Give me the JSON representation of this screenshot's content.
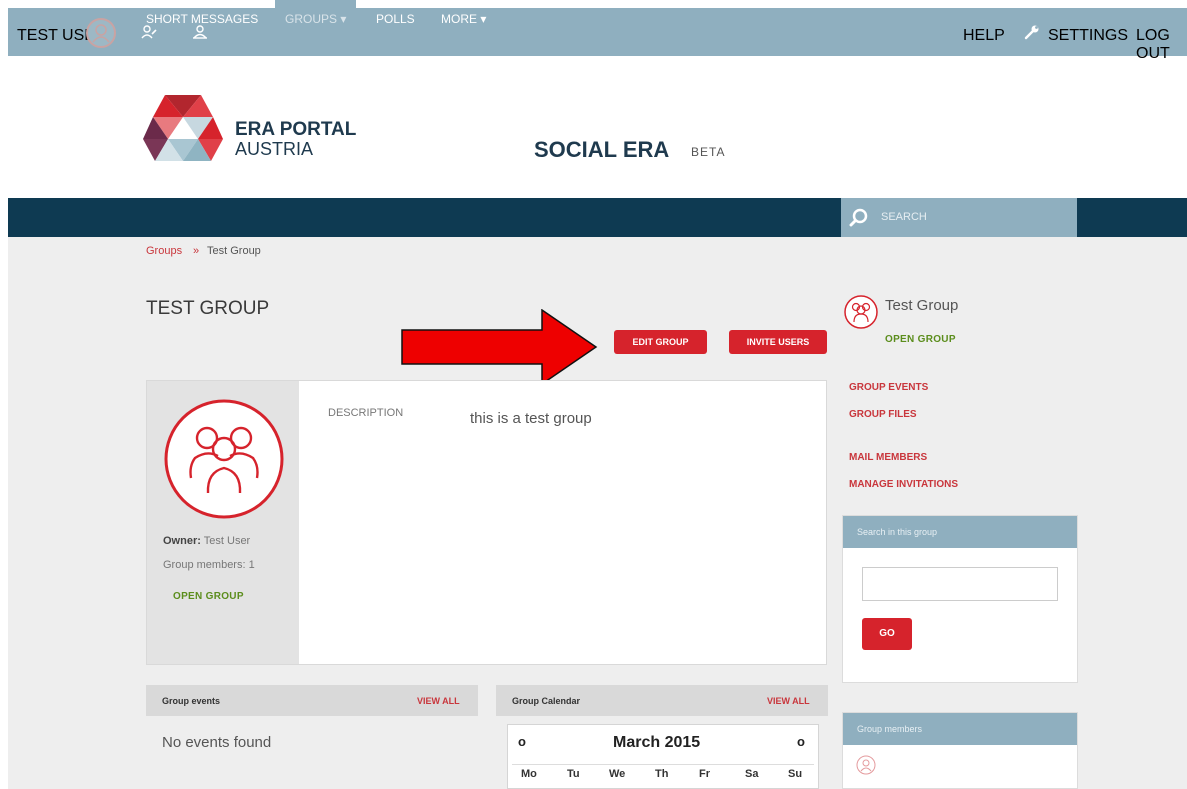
{
  "topbar": {
    "user_name": "TEST USER",
    "help": "HELP",
    "settings": "SETTINGS",
    "logout": "LOG OUT"
  },
  "header": {
    "brand_line1": "ERA PORTAL",
    "brand_line2": "AUSTRIA",
    "site_name": "SOCIAL ERA",
    "beta": "BETA"
  },
  "nav": {
    "items": [
      "SHORT MESSAGES",
      "GROUPS",
      "POLLS",
      "MORE"
    ],
    "active_index": 1,
    "search_placeholder": "SEARCH"
  },
  "breadcrumb": {
    "parent": "Groups",
    "separator": "»",
    "current": "Test Group"
  },
  "page": {
    "title": "TEST GROUP",
    "edit_group": "EDIT GROUP",
    "invite_users": "INVITE USERS"
  },
  "group_card": {
    "description_label": "DESCRIPTION",
    "description": "this is a test group",
    "owner_label": "Owner:",
    "owner": "Test User",
    "members_label": "Group members:",
    "members_count": "1",
    "status": "OPEN GROUP"
  },
  "sidebar": {
    "group_name": "Test Group",
    "status": "OPEN GROUP",
    "links": [
      "GROUP EVENTS",
      "GROUP FILES",
      "MAIL MEMBERS",
      "MANAGE INVITATIONS"
    ],
    "search_title": "Search in this group",
    "go": "GO",
    "members_title": "Group members"
  },
  "events_panel": {
    "title": "Group events",
    "view_all": "VIEW ALL",
    "empty": "No events found"
  },
  "calendar_panel": {
    "title": "Group Calendar",
    "view_all": "VIEW ALL",
    "month": "March 2015",
    "days": [
      "Mo",
      "Tu",
      "We",
      "Th",
      "Fr",
      "Sa",
      "Su"
    ]
  },
  "colors": {
    "topbar": "#8fafbf",
    "nav": "#0e3a52",
    "accent_red": "#d6232c",
    "green": "#5b8d1c"
  }
}
